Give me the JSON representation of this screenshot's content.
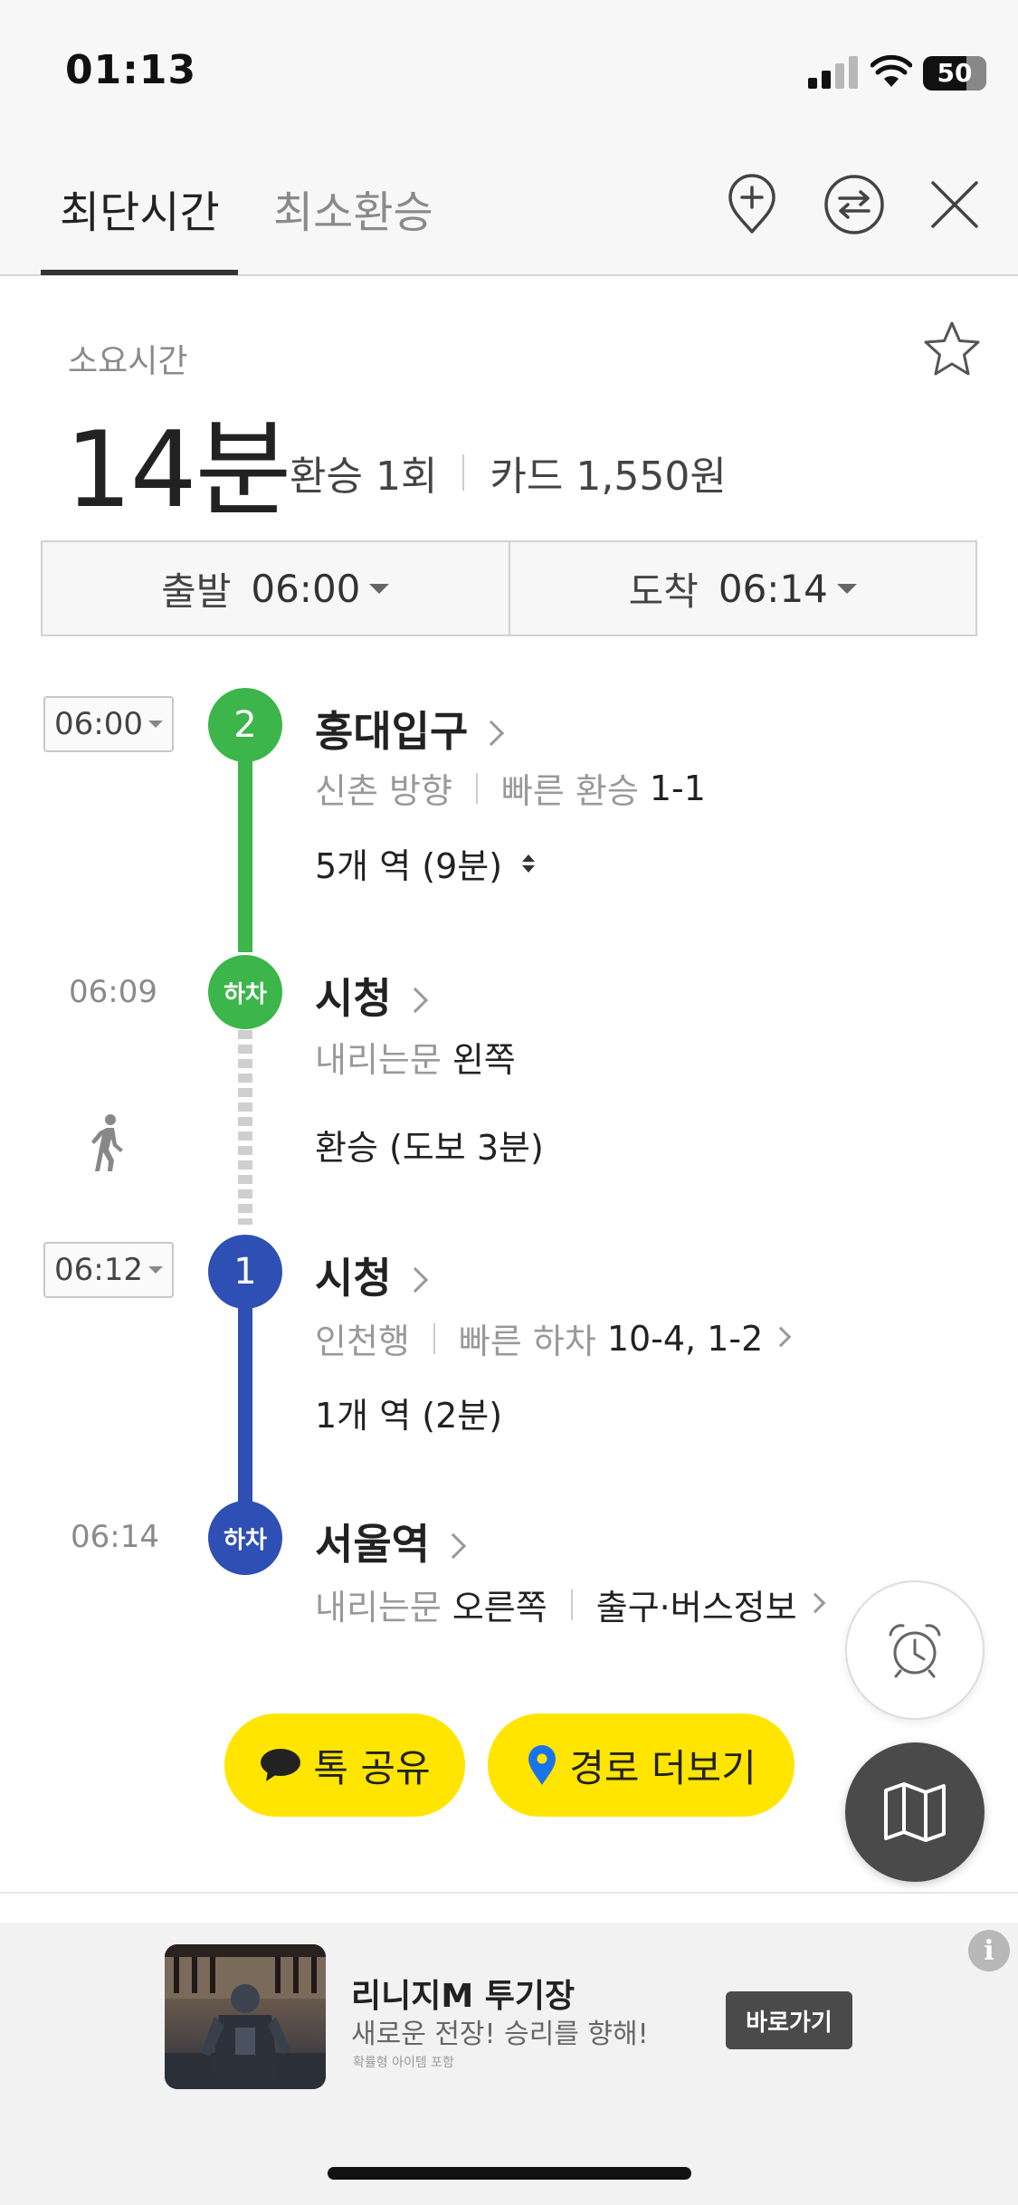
{
  "status": {
    "time": "01:13",
    "battery": "50"
  },
  "tabs": [
    {
      "label": "최단시간",
      "active": true
    },
    {
      "label": "최소환승",
      "active": false
    }
  ],
  "summary": {
    "label": "소요시간",
    "total": "14분",
    "transfers": "환승 1회",
    "fare": "카드 1,550원"
  },
  "times": {
    "depart_label": "출발",
    "depart": "06:00",
    "arrive_label": "도착",
    "arrive": "06:14"
  },
  "colors": {
    "line2": "#3cb54a",
    "line1": "#2e4fb3",
    "yellow": "#ffe500"
  },
  "route": {
    "leg1": {
      "time": "06:00",
      "badge": "2",
      "station": "홍대입구",
      "direction": "신촌 방향",
      "fast_label": "빠른 환승",
      "fast_value": "1-1",
      "stops": "5개 역 (9분)"
    },
    "alight1": {
      "time": "06:09",
      "badge": "하차",
      "station": "시청",
      "door_label": "내리는문",
      "door_value": "왼쪽"
    },
    "transfer": {
      "text": "환승 (도보 3분)"
    },
    "leg2": {
      "time": "06:12",
      "badge": "1",
      "station": "시청",
      "direction": "인천행",
      "fast_label": "빠른 하차",
      "fast_value": "10-4, 1-2",
      "stops": "1개 역 (2분)"
    },
    "alight2": {
      "time": "06:14",
      "badge": "하차",
      "station": "서울역",
      "door_label": "내리는문",
      "door_value": "오른쪽",
      "exit_info": "출구·버스정보"
    }
  },
  "actions": {
    "share": "톡 공유",
    "more_routes": "경로 더보기"
  },
  "ad": {
    "title": "리니지M 투기장",
    "desc": "새로운 전장! 승리를 향해!",
    "note": "확률형 아이템 포함",
    "button": "바로가기",
    "info": "i"
  }
}
